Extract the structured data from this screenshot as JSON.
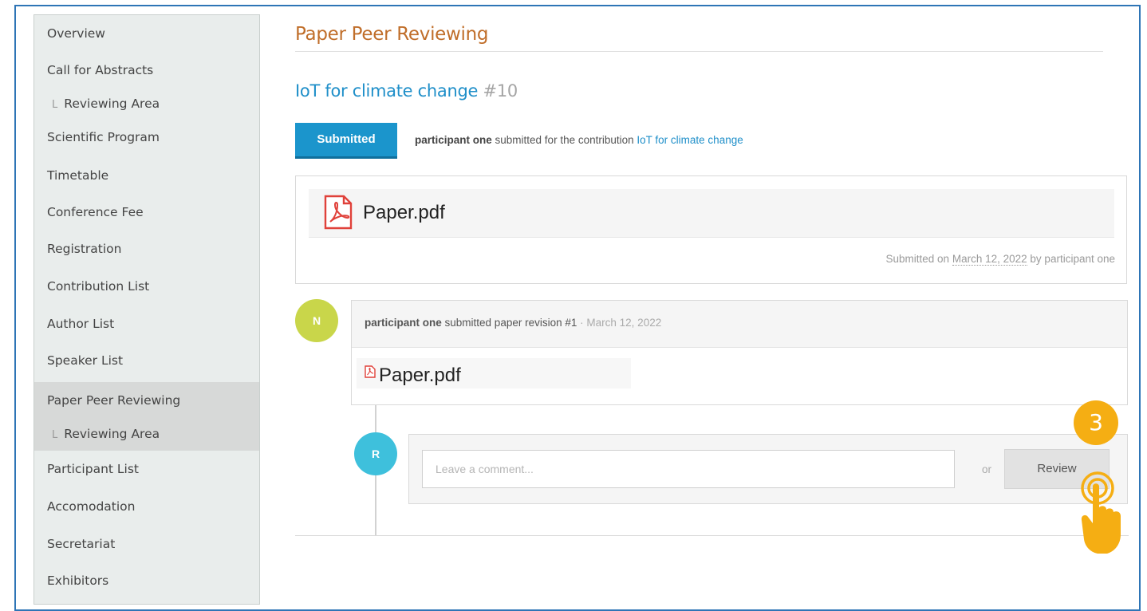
{
  "sidebar": {
    "items": [
      {
        "label": "Overview"
      },
      {
        "label": "Call for Abstracts"
      },
      {
        "label": "Reviewing Area",
        "sub": true
      },
      {
        "label": "Scientific Program"
      },
      {
        "label": "Timetable"
      },
      {
        "label": "Conference Fee"
      },
      {
        "label": "Registration"
      },
      {
        "label": "Contribution List"
      },
      {
        "label": "Author List"
      },
      {
        "label": "Speaker List"
      },
      {
        "label": "Paper Peer Reviewing",
        "active": true
      },
      {
        "label": "Reviewing Area",
        "sub": true,
        "active": true
      },
      {
        "label": "Participant List"
      },
      {
        "label": "Accomodation"
      },
      {
        "label": "Secretariat"
      },
      {
        "label": "Exhibitors"
      }
    ],
    "sub_marker": "L"
  },
  "main": {
    "title": "Paper Peer Reviewing",
    "contribution_title": "IoT for climate change",
    "contribution_number": "#10",
    "status": {
      "badge": "Submitted",
      "actor": "participant one",
      "text": "submitted for the contribution",
      "link": "IoT for climate change"
    },
    "file": {
      "name": "Paper.pdf",
      "meta_prefix": "Submitted on",
      "meta_date": "March 12, 2022",
      "meta_suffix": "by participant one"
    },
    "revision": {
      "avatar": "N",
      "actor": "participant one",
      "text": "submitted paper revision #1",
      "separator": "·",
      "date": "March 12, 2022",
      "file_name": "Paper.pdf"
    },
    "comment": {
      "avatar": "R",
      "placeholder": "Leave a comment...",
      "or": "or",
      "review_label": "Review"
    }
  },
  "overlay": {
    "step_number": "3",
    "pointer_icon": "hand-pointer-icon"
  },
  "colors": {
    "accent_blue": "#1b95cc",
    "title_orange": "#c06e2a",
    "step_badge": "#f5ae13",
    "avatar_n": "#c9d64a",
    "avatar_r": "#3ec0dc",
    "pdf_red": "#e0413a"
  }
}
